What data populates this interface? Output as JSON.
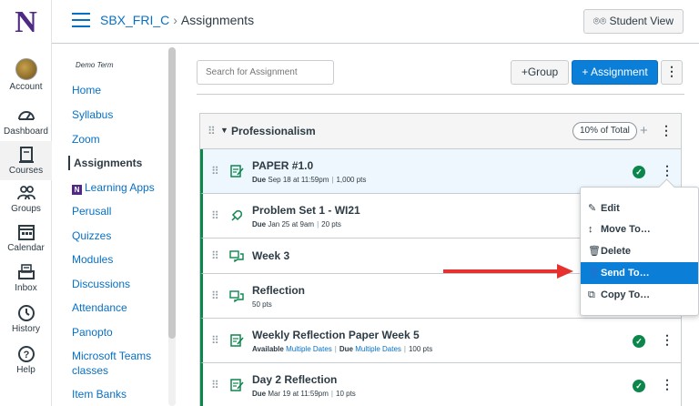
{
  "global_nav": {
    "logo": "N",
    "items": [
      {
        "label": "Account",
        "icon": "avatar-icon"
      },
      {
        "label": "Dashboard",
        "icon": "dashboard-icon"
      },
      {
        "label": "Courses",
        "icon": "courses-icon"
      },
      {
        "label": "Groups",
        "icon": "groups-icon"
      },
      {
        "label": "Calendar",
        "icon": "calendar-icon"
      },
      {
        "label": "Inbox",
        "icon": "inbox-icon"
      },
      {
        "label": "History",
        "icon": "history-icon"
      },
      {
        "label": "Help",
        "icon": "help-icon"
      }
    ]
  },
  "header": {
    "course": "SBX_FRI_C",
    "separator": "›",
    "page": "Assignments",
    "student_view": "Student View"
  },
  "course_nav": {
    "term": "Demo Term",
    "items": [
      "Home",
      "Syllabus",
      "Zoom",
      "Assignments",
      "Learning Apps",
      "Perusall",
      "Quizzes",
      "Modules",
      "Discussions",
      "Attendance",
      "Panopto",
      "Microsoft Teams classes",
      "Item Banks"
    ]
  },
  "toolbar": {
    "search_placeholder": "Search for Assignment",
    "group_btn": "+Group",
    "assignment_btn": "+ Assignment",
    "kebab": "⋮"
  },
  "group": {
    "title": "Professionalism",
    "percent": "10% of Total",
    "rows": [
      {
        "title": "PAPER #1.0",
        "due_label": "Due",
        "due": "Sep 18 at 11:59pm",
        "pts": "1,000 pts",
        "published": true
      },
      {
        "title": "Problem Set 1 - WI21",
        "due_label": "Due",
        "due": "Jan 25 at 9am",
        "pts": "20 pts",
        "published": false
      },
      {
        "title": "Week 3",
        "published": false
      },
      {
        "title": "Reflection",
        "pts": "50 pts",
        "published": false
      },
      {
        "title": "Weekly Reflection Paper Week 5",
        "available_label": "Available",
        "available": "Multiple Dates",
        "due_label": "Due",
        "due": "Multiple Dates",
        "pts": "100 pts",
        "published": true
      },
      {
        "title": "Day 2 Reflection",
        "due_label": "Due",
        "due": "Mar 19 at 11:59pm",
        "pts": "10 pts",
        "published": true
      }
    ]
  },
  "menu": {
    "items": [
      {
        "label": "Edit",
        "icon": "✎"
      },
      {
        "label": "Move To…",
        "icon": "↕"
      },
      {
        "label": "Delete",
        "icon": "🗑"
      },
      {
        "label": "Send To…",
        "icon": "👤"
      },
      {
        "label": "Copy To…",
        "icon": "⧉"
      }
    ]
  },
  "colors": {
    "accent": "#0b7fd8",
    "brand": "#4e2a84",
    "published": "#0b874b",
    "arrow": "#e5322f"
  }
}
